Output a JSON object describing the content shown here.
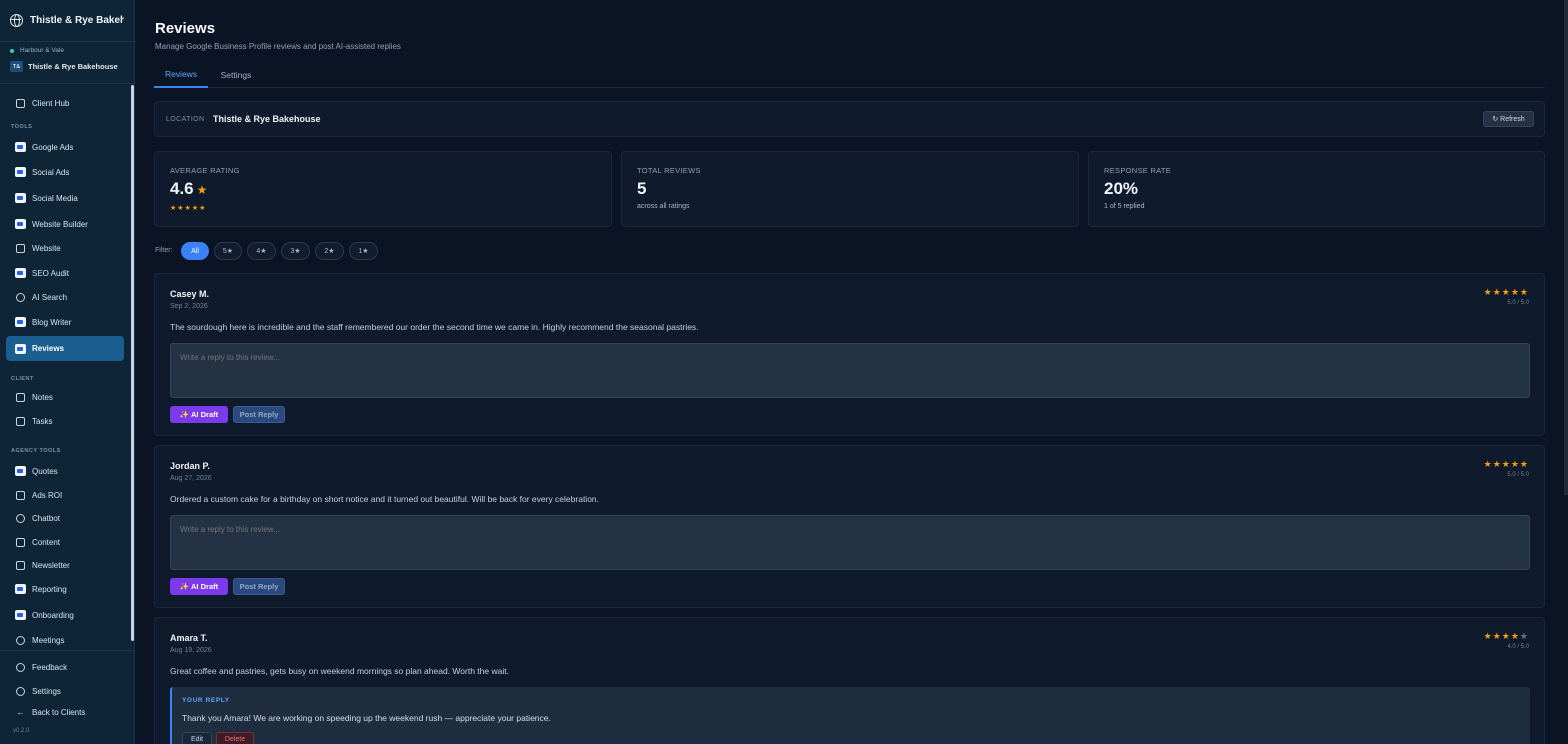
{
  "sidebar": {
    "brand": "Thistle & Rye Bakeho...",
    "agency": "Harbour & Vale",
    "client_badge": "T&",
    "client_name": "Thistle & Rye Bakehouse",
    "client_hub": "Client Hub",
    "section_tools": "TOOLS",
    "tools": [
      "Google Ads",
      "Social Ads",
      "Social Media",
      "Website Builder",
      "Website",
      "SEO Audit",
      "AI Search",
      "Blog Writer",
      "Reviews"
    ],
    "section_client": "CLIENT",
    "client_items": [
      "Notes",
      "Tasks"
    ],
    "section_agency": "AGENCY TOOLS",
    "agency_items": [
      "Quotes",
      "Ads ROI",
      "Chatbot",
      "Content",
      "Newsletter",
      "Reporting",
      "Onboarding",
      "Meetings"
    ],
    "footer": [
      "Feedback",
      "Settings",
      "Back to Clients"
    ],
    "version": "v0.2.0"
  },
  "header": {
    "title": "Reviews",
    "subtitle": "Manage Google Business Profile reviews and post AI-assisted replies",
    "tabs": [
      "Reviews",
      "Settings"
    ]
  },
  "location": {
    "label": "LOCATION",
    "name": "Thistle & Rye Bakehouse",
    "refresh": "↻ Refresh"
  },
  "stats": {
    "avg_label": "AVERAGE RATING",
    "avg_value": "4.6",
    "avg_star": "★",
    "avg_stars": "★★★★★",
    "total_label": "TOTAL REVIEWS",
    "total_value": "5",
    "total_sub": "across all ratings",
    "rate_label": "RESPONSE RATE",
    "rate_value": "20%",
    "rate_sub": "1 of 5 replied"
  },
  "filter": {
    "label": "Filter:",
    "options": [
      "All",
      "5★",
      "4★",
      "3★",
      "2★",
      "1★"
    ],
    "selected": "All"
  },
  "reviews": [
    {
      "name": "Casey M.",
      "date": "Sep 2, 2026",
      "stars": "★★★★★",
      "stars_empty": "",
      "score": "5.0 / 5.0",
      "text": "The sourdough here is incredible and the staff remembered our order the second time we came in. Highly recommend the seasonal pastries.",
      "placeholder": "Write a reply to this review...",
      "ai_draft": "✨ AI Draft",
      "post_reply": "Post Reply"
    },
    {
      "name": "Jordan P.",
      "date": "Aug 27, 2026",
      "stars": "★★★★★",
      "stars_empty": "",
      "score": "5.0 / 5.0",
      "text": "Ordered a custom cake for a birthday on short notice and it turned out beautiful. Will be back for every celebration.",
      "placeholder": "Write a reply to this review...",
      "ai_draft": "✨ AI Draft",
      "post_reply": "Post Reply"
    },
    {
      "name": "Amara T.",
      "date": "Aug 19, 2026",
      "stars": "★★★★",
      "stars_empty": "★",
      "score": "4.0 / 5.0",
      "text": "Great coffee and pastries, gets busy on weekend mornings so plan ahead. Worth the wait.",
      "reply_label": "YOUR REPLY",
      "reply_text": "Thank you Amara! We are working on speeding up the weekend rush — appreciate your patience.",
      "edit": "Edit",
      "delete": "Delete"
    }
  ]
}
